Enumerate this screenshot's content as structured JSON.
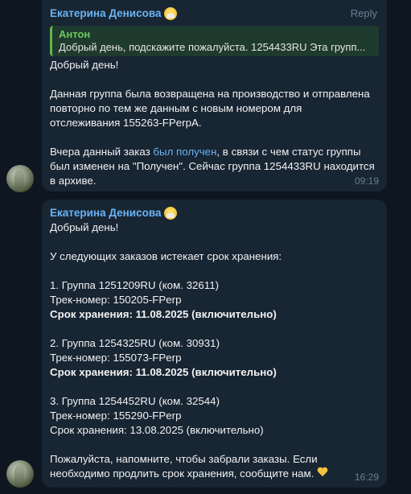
{
  "message1": {
    "sender": "Екатерина Денисова",
    "reply_action": "Reply",
    "quote": {
      "author": "Антон",
      "text": "Добрый день, подскажите пожалуйста. 1254433RU Эта групп..."
    },
    "lines": {
      "greeting": "Добрый день!",
      "p1_l1": "Данная группа была возвращена на производство и отправлена",
      "p1_l2": "повторно по тем же данным с новым номером для",
      "p1_l3": "отслеживания 155263-FPerpA.",
      "p2_l1_a": "Вчера данный заказ ",
      "p2_l1_link": "был получен",
      "p2_l1_b": ", в связи с чем статус группы",
      "p2_l2": "был изменен на \"Получен\". Сейчас  группа 1254433RU находится",
      "p2_l3": "в архиве."
    },
    "time": "09:19"
  },
  "message2": {
    "sender": "Екатерина Денисова",
    "lines": {
      "greeting": "Добрый день!",
      "intro": "У следующих заказов истекает срок хранения:",
      "g1_group": "1. Группа 1251209RU  (ком. 32611)",
      "g1_track": "Трек-номер: 150205-FPerp",
      "g1_storage": "Срок хранения: 11.08.2025 (включительно)",
      "g2_group": "2. Группа 1254325RU  (ком. 30931)",
      "g2_track": "Трек-номер:  155073-FPerp",
      "g2_storage": "Срок хранения: 11.08.2025 (включительно)",
      "g3_group": "3. Группа 1254452RU (ком. 32544)",
      "g3_track": "Трек-номер:  155290-FPerp",
      "g3_storage": "Срок хранения: 13.08.2025 (включительно)",
      "outro_l1": "Пожалуйста, напомните, чтобы забрали заказы. Если",
      "outro_l2": "необходимо продлить срок хранения, сообщите нам."
    },
    "time": "16:29"
  },
  "icons": {
    "sender_emoji": "mask-face-icon",
    "heart": "yellow-heart-icon"
  },
  "colors": {
    "background": "#0e1621",
    "bubble": "#182533",
    "sender": "#6ab3f3",
    "quote_accent": "#5fb849"
  }
}
